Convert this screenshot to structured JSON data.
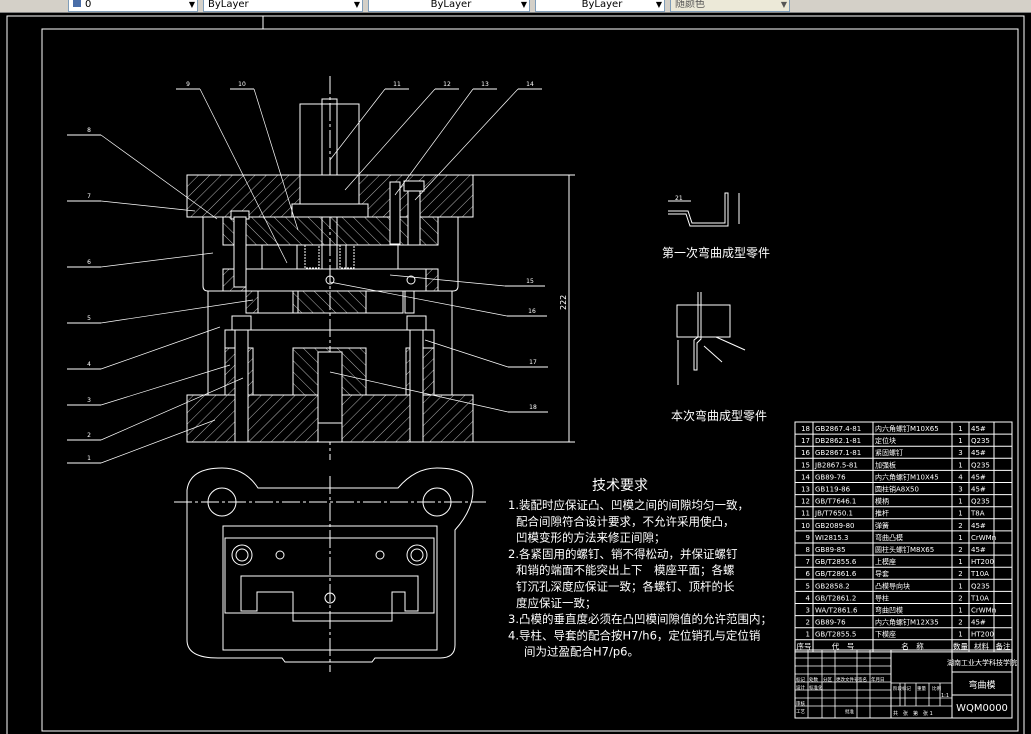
{
  "toolbar": {
    "layer_combo": "0",
    "color_combo": "ByLayer",
    "linetype_combo": "ByLayer",
    "lineweight_combo": "ByLayer",
    "plotstyle_combo": "随颜色"
  },
  "drawing": {
    "background": "#000000",
    "line_color": "#ffffff",
    "part_labels": [
      "1",
      "2",
      "3",
      "4",
      "5",
      "6",
      "7",
      "8",
      "9",
      "10",
      "11",
      "12",
      "13",
      "14",
      "15",
      "16",
      "17",
      "18"
    ],
    "overall_height_dim": "222",
    "first_bend_caption": "第一次弯曲成型零件",
    "first_bend_dim": "21",
    "this_bend_caption": "本次弯曲成型零件"
  },
  "tech_requirements": {
    "title": "技术要求",
    "lines": [
      "1.装配时应保证凸、凹模之间的间隙均匀一致，",
      "配合间隙符合设计要求，不允许采用使凸，",
      "凹模变形的方法来修正间隙；",
      "2.各紧固用的螺钉、销不得松动，并保证螺钉",
      "和销的端面不能突出上下　模座平面；各螺",
      "钉沉孔深度应保证一致；各螺钉、顶杆的长",
      "度应保证一致；",
      "3.凸模的垂直度必须在凸凹模间隙值的允许范围内；",
      "4.导柱、导套的配合按H7/h6，定位销孔与定位销",
      "间为过盈配合H7/p6。"
    ]
  },
  "bom": {
    "headers": [
      "序号",
      "代　号",
      "名　称",
      "数量",
      "材料",
      "备注"
    ],
    "rows": [
      [
        "18",
        "GB2867.4-81",
        "内六角螺钉M10X65",
        "1",
        "45#",
        ""
      ],
      [
        "17",
        "DB2862.1-81",
        "定位块",
        "1",
        "Q235",
        ""
      ],
      [
        "16",
        "GB2867.1-81",
        "紧固螺钉",
        "3",
        "45#",
        ""
      ],
      [
        "15",
        "JB2867.5-81",
        "加强板",
        "1",
        "Q235",
        ""
      ],
      [
        "14",
        "GB89-76",
        "内六角螺钉M10X45",
        "4",
        "45#",
        ""
      ],
      [
        "13",
        "GB119-86",
        "圆柱销A8X50",
        "3",
        "45#",
        ""
      ],
      [
        "12",
        "GB/T7646.1",
        "模柄",
        "1",
        "Q235",
        ""
      ],
      [
        "11",
        "JB/T7650.1",
        "推杆",
        "1",
        "T8A",
        ""
      ],
      [
        "10",
        "GB2089-80",
        "弹簧",
        "2",
        "45#",
        ""
      ],
      [
        "9",
        "WI2815.3",
        "弯曲凸模",
        "1",
        "CrWMn",
        ""
      ],
      [
        "8",
        "GB89-85",
        "圆柱头螺钉M8X65",
        "2",
        "45#",
        ""
      ],
      [
        "7",
        "GB/T2855.6",
        "上模座",
        "1",
        "HT200",
        ""
      ],
      [
        "6",
        "GB/T2861.6",
        "导套",
        "2",
        "T10A",
        ""
      ],
      [
        "5",
        "GB2858.2",
        "凸模导向块",
        "1",
        "Q235",
        ""
      ],
      [
        "4",
        "GB/T2861.2",
        "导柱",
        "2",
        "T10A",
        ""
      ],
      [
        "3",
        "WA/T2861.6",
        "弯曲凹模",
        "1",
        "CrWMn",
        ""
      ],
      [
        "2",
        "GB89-76",
        "内六角螺钉M12X35",
        "2",
        "45#",
        ""
      ],
      [
        "1",
        "GB/T2855.5",
        "下模座",
        "1",
        "HT200",
        ""
      ]
    ]
  },
  "title_block": {
    "school": "湖南工业大学科技学院",
    "drawing_name": "弯曲模",
    "drawing_number": "WQM0000",
    "labels": [
      "标记",
      "处数",
      "分区",
      "更改文件号",
      "签名",
      "年月日",
      "设计",
      "标准化",
      "审核",
      "工艺",
      "批准",
      "阶段标记",
      "重量",
      "比例"
    ],
    "scale": "1:1",
    "sheet": "共　张　第　张 1"
  }
}
